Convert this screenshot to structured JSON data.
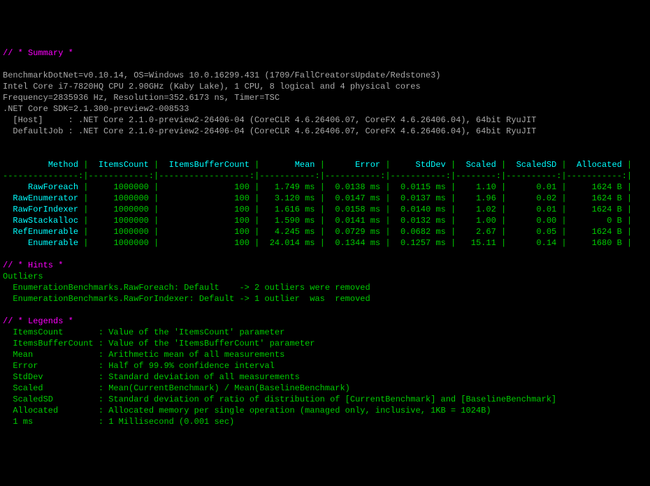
{
  "sections": {
    "summary": "// * Summary *",
    "hints": "// * Hints *",
    "legends": "// * Legends *"
  },
  "env": {
    "line1": "BenchmarkDotNet=v0.10.14, OS=Windows 10.0.16299.431 (1709/FallCreatorsUpdate/Redstone3)",
    "line2": "Intel Core i7-7820HQ CPU 2.90GHz (Kaby Lake), 1 CPU, 8 logical and 4 physical cores",
    "line3": "Frequency=2835936 Hz, Resolution=352.6173 ns, Timer=TSC",
    "line4": ".NET Core SDK=2.1.300-preview2-008533",
    "line5": "  [Host]     : .NET Core 2.1.0-preview2-26406-04 (CoreCLR 4.6.26406.07, CoreFX 4.6.26406.04), 64bit RyuJIT",
    "line6": "  DefaultJob : .NET Core 2.1.0-preview2-26406-04 (CoreCLR 4.6.26406.07, CoreFX 4.6.26406.04), 64bit RyuJIT"
  },
  "table": {
    "headers": [
      "Method",
      "ItemsCount",
      "ItemsBufferCount",
      "Mean",
      "Error",
      "StdDev",
      "Scaled",
      "ScaledSD",
      "Allocated"
    ],
    "rows": [
      {
        "method": "RawForeach",
        "items": "1000000",
        "buf": "100",
        "mean": "1.749 ms",
        "err": "0.0138 ms",
        "std": "0.0115 ms",
        "scaled": "1.10",
        "scaledsd": "0.01",
        "alloc": "1624 B"
      },
      {
        "method": "RawEnumerator",
        "items": "1000000",
        "buf": "100",
        "mean": "3.120 ms",
        "err": "0.0147 ms",
        "std": "0.0137 ms",
        "scaled": "1.96",
        "scaledsd": "0.02",
        "alloc": "1624 B"
      },
      {
        "method": "RawForIndexer",
        "items": "1000000",
        "buf": "100",
        "mean": "1.616 ms",
        "err": "0.0158 ms",
        "std": "0.0140 ms",
        "scaled": "1.02",
        "scaledsd": "0.01",
        "alloc": "1624 B"
      },
      {
        "method": "RawStackalloc",
        "items": "1000000",
        "buf": "100",
        "mean": "1.590 ms",
        "err": "0.0141 ms",
        "std": "0.0132 ms",
        "scaled": "1.00",
        "scaledsd": "0.00",
        "alloc": "0 B"
      },
      {
        "method": "RefEnumerable",
        "items": "1000000",
        "buf": "100",
        "mean": "4.245 ms",
        "err": "0.0729 ms",
        "std": "0.0682 ms",
        "scaled": "2.67",
        "scaledsd": "0.05",
        "alloc": "1624 B"
      },
      {
        "method": "Enumerable",
        "items": "1000000",
        "buf": "100",
        "mean": "24.014 ms",
        "err": "0.1344 ms",
        "std": "0.1257 ms",
        "scaled": "15.11",
        "scaledsd": "0.14",
        "alloc": "1680 B"
      }
    ]
  },
  "outliers": {
    "heading": "Outliers",
    "l1": "  EnumerationBenchmarks.RawForeach: Default    -> 2 outliers were removed",
    "l2": "  EnumerationBenchmarks.RawForIndexer: Default -> 1 outlier  was  removed"
  },
  "legends": [
    {
      "k": "ItemsCount",
      "v": "Value of the 'ItemsCount' parameter"
    },
    {
      "k": "ItemsBufferCount",
      "v": "Value of the 'ItemsBufferCount' parameter"
    },
    {
      "k": "Mean",
      "v": "Arithmetic mean of all measurements"
    },
    {
      "k": "Error",
      "v": "Half of 99.9% confidence interval"
    },
    {
      "k": "StdDev",
      "v": "Standard deviation of all measurements"
    },
    {
      "k": "Scaled",
      "v": "Mean(CurrentBenchmark) / Mean(BaselineBenchmark)"
    },
    {
      "k": "ScaledSD",
      "v": "Standard deviation of ratio of distribution of [CurrentBenchmark] and [BaselineBenchmark]"
    },
    {
      "k": "Allocated",
      "v": "Allocated memory per single operation (managed only, inclusive, 1KB = 1024B)"
    },
    {
      "k": "1 ms",
      "v": "1 Millisecond (0.001 sec)"
    }
  ],
  "chart_data": {
    "type": "table",
    "title": "BenchmarkDotNet results",
    "columns": [
      "Method",
      "ItemsCount",
      "ItemsBufferCount",
      "Mean (ms)",
      "Error (ms)",
      "StdDev (ms)",
      "Scaled",
      "ScaledSD",
      "Allocated (B)"
    ],
    "rows": [
      [
        "RawForeach",
        1000000,
        100,
        1.749,
        0.0138,
        0.0115,
        1.1,
        0.01,
        1624
      ],
      [
        "RawEnumerator",
        1000000,
        100,
        3.12,
        0.0147,
        0.0137,
        1.96,
        0.02,
        1624
      ],
      [
        "RawForIndexer",
        1000000,
        100,
        1.616,
        0.0158,
        0.014,
        1.02,
        0.01,
        1624
      ],
      [
        "RawStackalloc",
        1000000,
        100,
        1.59,
        0.0141,
        0.0132,
        1.0,
        0.0,
        0
      ],
      [
        "RefEnumerable",
        1000000,
        100,
        4.245,
        0.0729,
        0.0682,
        2.67,
        0.05,
        1624
      ],
      [
        "Enumerable",
        1000000,
        100,
        24.014,
        0.1344,
        0.1257,
        15.11,
        0.14,
        1680
      ]
    ]
  }
}
